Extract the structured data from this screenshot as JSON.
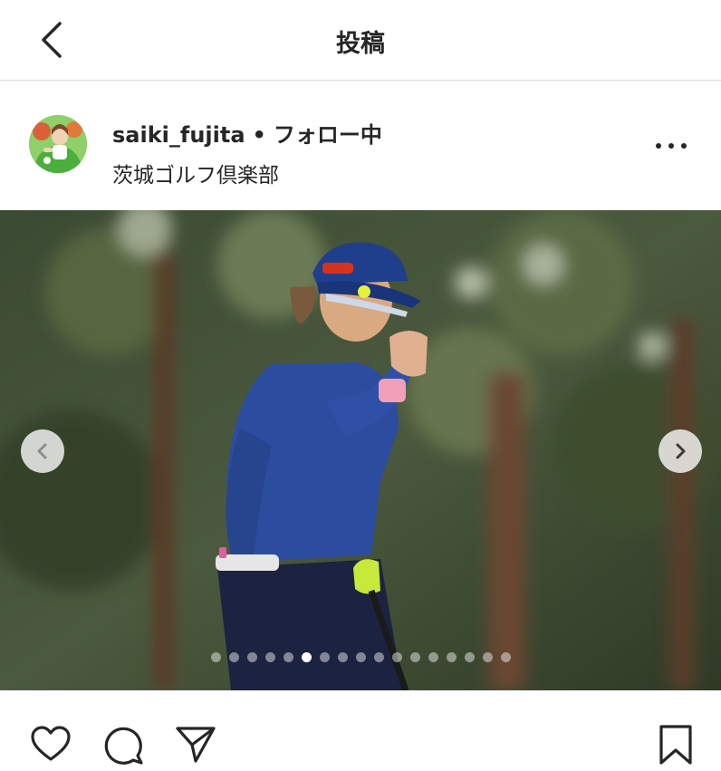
{
  "header": {
    "title": "投稿",
    "back_icon": "chevron-left-icon"
  },
  "post": {
    "username": "saiki_fujita",
    "separator": "•",
    "follow_status": "フォロー中",
    "location": "茨城ゴルフ倶楽部",
    "more_icon": "more-horizontal-icon"
  },
  "carousel": {
    "total_images": 17,
    "active_index": 5,
    "prev_icon": "chevron-left-icon",
    "next_icon": "chevron-right-icon"
  },
  "actions": {
    "like_icon": "heart-icon",
    "comment_icon": "comment-icon",
    "share_icon": "paper-plane-icon",
    "save_icon": "bookmark-icon"
  },
  "colors": {
    "text": "#262626",
    "divider": "#dbdbdb",
    "background": "#ffffff"
  }
}
